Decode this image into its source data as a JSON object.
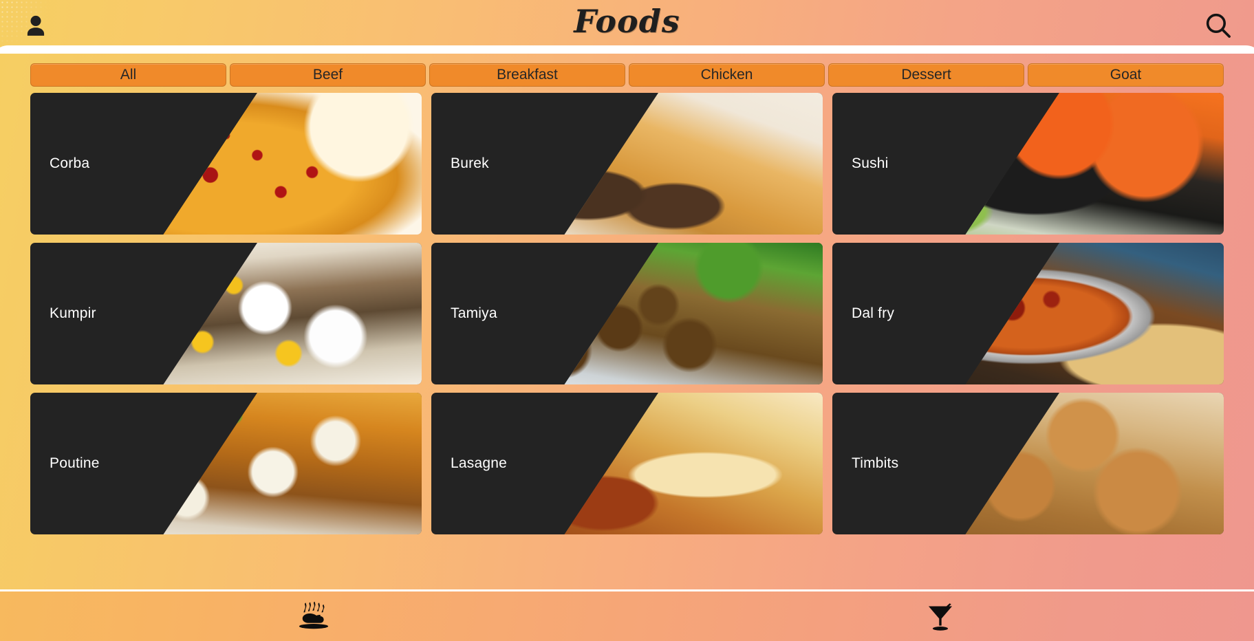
{
  "header": {
    "title": "Foods",
    "avatar_icon": "person-icon",
    "search_icon": "search-icon"
  },
  "tabs": [
    {
      "label": "All",
      "active": true
    },
    {
      "label": "Beef",
      "active": false
    },
    {
      "label": "Breakfast",
      "active": false
    },
    {
      "label": "Chicken",
      "active": false
    },
    {
      "label": "Dessert",
      "active": false
    },
    {
      "label": "Goat",
      "active": false
    }
  ],
  "cards": [
    {
      "name": "Corba",
      "photo_class": "ph-corba"
    },
    {
      "name": "Burek",
      "photo_class": "ph-burek"
    },
    {
      "name": "Sushi",
      "photo_class": "ph-sushi"
    },
    {
      "name": "Kumpir",
      "photo_class": "ph-kumpir"
    },
    {
      "name": "Tamiya",
      "photo_class": "ph-tamiya"
    },
    {
      "name": "Dal fry",
      "photo_class": "ph-dalfry"
    },
    {
      "name": "Poutine",
      "photo_class": "ph-poutine"
    },
    {
      "name": "Lasagne",
      "photo_class": "ph-lasagne"
    },
    {
      "name": "Timbits",
      "photo_class": "ph-timbits"
    }
  ],
  "bottom_nav": [
    {
      "icon": "roast-turkey-icon",
      "label": ""
    },
    {
      "icon": "cocktail-glass-icon",
      "label": ""
    }
  ],
  "colors": {
    "background_start": "#f6cf62",
    "background_end": "#ef978e",
    "tab_fill": "#f08a2a",
    "card_fill": "#232323",
    "card_text": "#ffffff",
    "title_text": "#1f1f1f"
  }
}
